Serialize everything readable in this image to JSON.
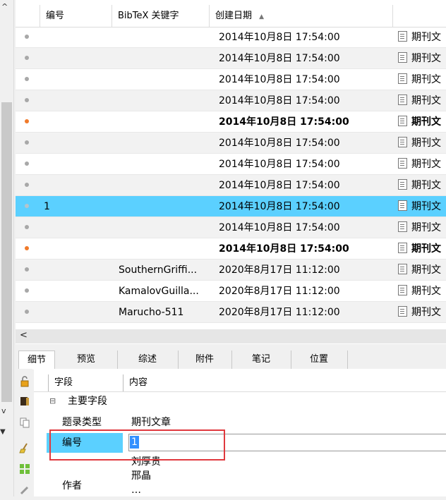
{
  "list": {
    "columns": [
      "编号",
      "BibTeX 关键字",
      "创建日期"
    ],
    "sort_indicator": "▲",
    "rows": [
      {
        "num": "",
        "key": "",
        "date": "2014年10月8日 17:54:00",
        "type": "期刊文",
        "dot": "gray",
        "bold": false,
        "selected": false
      },
      {
        "num": "",
        "key": "",
        "date": "2014年10月8日 17:54:00",
        "type": "期刊文",
        "dot": "gray",
        "bold": false,
        "selected": false
      },
      {
        "num": "",
        "key": "",
        "date": "2014年10月8日 17:54:00",
        "type": "期刊文",
        "dot": "gray",
        "bold": false,
        "selected": false
      },
      {
        "num": "",
        "key": "",
        "date": "2014年10月8日 17:54:00",
        "type": "期刊文",
        "dot": "gray",
        "bold": false,
        "selected": false
      },
      {
        "num": "",
        "key": "",
        "date": "2014年10月8日 17:54:00",
        "type": "期刊文",
        "dot": "orange",
        "bold": true,
        "selected": false
      },
      {
        "num": "",
        "key": "",
        "date": "2014年10月8日 17:54:00",
        "type": "期刊文",
        "dot": "gray",
        "bold": false,
        "selected": false
      },
      {
        "num": "",
        "key": "",
        "date": "2014年10月8日 17:54:00",
        "type": "期刊文",
        "dot": "gray",
        "bold": false,
        "selected": false
      },
      {
        "num": "",
        "key": "",
        "date": "2014年10月8日 17:54:00",
        "type": "期刊文",
        "dot": "gray",
        "bold": false,
        "selected": false
      },
      {
        "num": "1",
        "key": "",
        "date": "2014年10月8日 17:54:00",
        "type": "期刊文",
        "dot": "gray",
        "bold": false,
        "selected": true
      },
      {
        "num": "",
        "key": "",
        "date": "2014年10月8日 17:54:00",
        "type": "期刊文",
        "dot": "gray",
        "bold": false,
        "selected": false
      },
      {
        "num": "",
        "key": "",
        "date": "2014年10月8日 17:54:00",
        "type": "期刊文",
        "dot": "orange",
        "bold": true,
        "selected": false
      },
      {
        "num": "",
        "key": "SouthernGriffi...",
        "date": "2020年8月17日 11:12:00",
        "type": "期刊文",
        "dot": "gray",
        "bold": false,
        "selected": false
      },
      {
        "num": "",
        "key": "KamalovGuilla...",
        "date": "2020年8月17日 11:12:00",
        "type": "期刊文",
        "dot": "gray",
        "bold": false,
        "selected": false
      },
      {
        "num": "",
        "key": "Marucho-511",
        "date": "2020年8月17日 11:12:00",
        "type": "期刊文",
        "dot": "gray",
        "bold": false,
        "selected": false
      }
    ]
  },
  "scroll": {
    "left_arrow": "<",
    "up_arrow": "^",
    "down_arrow": "v",
    "collapse_arrow": "▼"
  },
  "tabs": [
    "细节",
    "预览",
    "综述",
    "附件",
    "笔记",
    "位置"
  ],
  "grid": {
    "header_field": "字段",
    "header_content": "内容",
    "group_label": "主要字段",
    "group_toggle": "⊟",
    "rows": [
      {
        "label": "题录类型",
        "value": "期刊文章"
      },
      {
        "label": "编号",
        "value": "1"
      },
      {
        "label": "作者",
        "value_lines": [
          "刘厚贵",
          "邢晶",
          "…"
        ]
      }
    ]
  },
  "colors": {
    "selection": "#5bd0ff",
    "dot_gray": "#a8a8a8",
    "dot_orange": "#f07a2a",
    "highlight_box": "#e0393e",
    "text_selection": "#3390ff"
  }
}
